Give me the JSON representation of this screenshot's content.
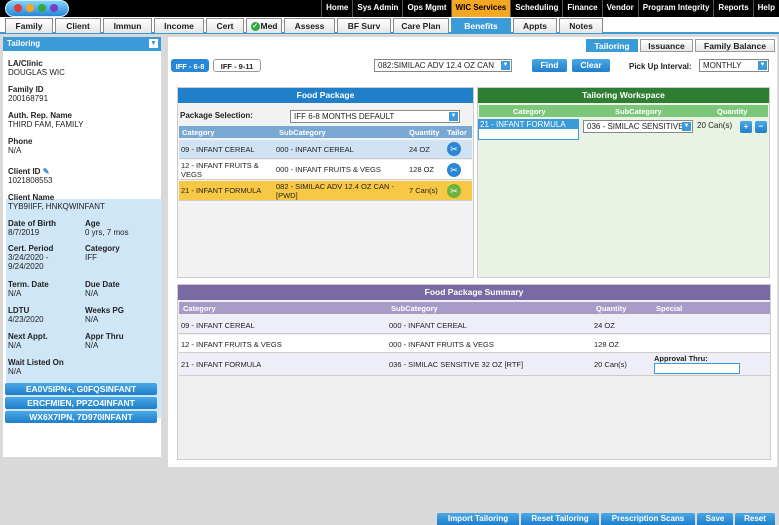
{
  "top_nav": [
    "Home",
    "Sys Admin",
    "Ops Mgmt",
    "WIC Services",
    "Scheduling",
    "Finance",
    "Vendor",
    "Program Integrity",
    "Reports",
    "Help"
  ],
  "top_nav_active": "WIC Services",
  "module_tabs": [
    "Family",
    "Client",
    "Immun",
    "Income",
    "Cert",
    "Med",
    "Assess",
    "BF Surv",
    "Care Plan",
    "Benefits",
    "Appts",
    "Notes"
  ],
  "module_tab_active": "Benefits",
  "left": {
    "dropdown": "Tailoring",
    "la_clinic_label": "LA/Clinic",
    "la_clinic": "DOUGLAS WIC",
    "family_id_label": "Family ID",
    "family_id": "200168791",
    "auth_rep_label": "Auth. Rep. Name",
    "auth_rep": "THIRD FAM, FAMILY",
    "phone_label": "Phone",
    "phone": "N/A",
    "client_id_label": "Client ID",
    "client_id": "1021808553",
    "client_name_label": "Client Name",
    "client_name": "TYB9IIFF, HNKQWINFANT",
    "dob_label": "Date of Birth",
    "dob": "8/7/2019",
    "age_label": "Age",
    "age": "0 yrs, 7 mos",
    "cert_period_label": "Cert. Period",
    "cert_period_1": "3/24/2020 -",
    "cert_period_2": "9/24/2020",
    "category_label": "Category",
    "category": "IFF",
    "term_label": "Term. Date",
    "term": "N/A",
    "due_label": "Due Date",
    "due": "N/A",
    "ldtu_label": "LDTU",
    "ldtu": "4/23/2020",
    "weeks_label": "Weeks PG",
    "weeks": "N/A",
    "next_appt_label": "Next Appt.",
    "next_appt": "N/A",
    "appr_thru_label": "Appr Thru",
    "appr_thru": "N/A",
    "wait_label": "Wait Listed On",
    "wait": "N/A",
    "participants": [
      "EA0V5IPN+, G0FQSINFANT",
      "ERCFMIEN, PPZO4INFANT",
      "WX6X7IPN, 7D970INFANT"
    ]
  },
  "main": {
    "tabs": [
      "Tailoring",
      "Issuance",
      "Family Balance"
    ],
    "active_tab": "Tailoring",
    "iff_buttons": [
      "IFF - 6-8",
      "IFF - 9-11"
    ],
    "product_select": "082:SIMILAC ADV 12.4 OZ CAN",
    "find": "Find",
    "clear": "Clear",
    "pickup_label": "Pick Up Interval:",
    "pickup_value": "MONTHLY",
    "food_package": {
      "title": "Food Package",
      "selection_label": "Package Selection:",
      "selection_value": "IFF 6-8 MONTHS DEFAULT",
      "headers": [
        "Category",
        "SubCategory",
        "Quantity",
        "Tailor"
      ],
      "rows": [
        {
          "category": "09 - INFANT CEREAL",
          "sub": "000 - INFANT CEREAL",
          "qty": "24 OZ"
        },
        {
          "category": "12 - INFANT FRUITS & VEGS",
          "sub": "000 - INFANT FRUITS & VEGS",
          "qty": "128 OZ"
        },
        {
          "category": "21 - INFANT FORMULA",
          "sub": "082 - SIMILAC ADV 12.4 OZ CAN - [PWD]",
          "qty": "7 Can(s)"
        }
      ]
    },
    "workspace": {
      "title": "Tailoring Workspace",
      "headers": [
        "Category",
        "SubCategory",
        "Quantity"
      ],
      "category": "21 - INFANT FORMULA",
      "sub": "036 - SIMILAC SENSITIVE",
      "qty": "20 Can(s)"
    },
    "summary": {
      "title": "Food Package Summary",
      "headers": [
        "Category",
        "SubCategory",
        "Quantity",
        "Special"
      ],
      "rows": [
        {
          "category": "09 - INFANT CEREAL",
          "sub": "000 - INFANT CEREAL",
          "qty": "24 OZ"
        },
        {
          "category": "12 - INFANT FRUITS & VEGS",
          "sub": "000 - INFANT FRUITS & VEGS",
          "qty": "128 OZ"
        },
        {
          "category": "21 - INFANT FORMULA",
          "sub": "036 - SIMILAC SENSITIVE 32 OZ [RTF]",
          "qty": "20 Can(s)"
        }
      ],
      "approval_label": "Approval Thru:"
    }
  },
  "bottom_buttons": [
    "Import Tailoring",
    "Reset Tailoring",
    "Prescription Scans",
    "Save",
    "Reset"
  ]
}
